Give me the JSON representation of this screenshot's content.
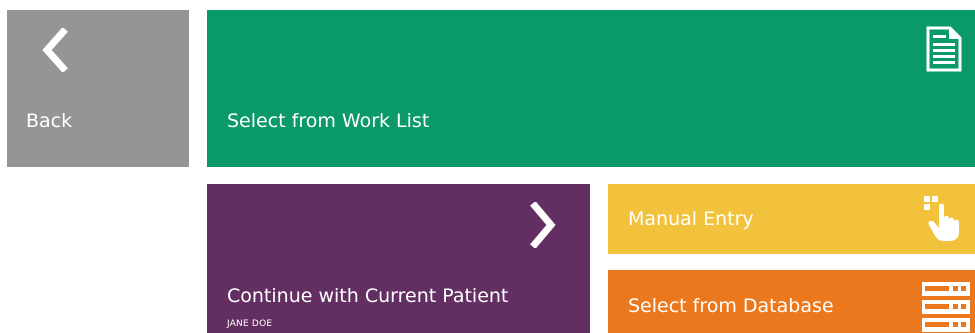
{
  "colors": {
    "back": "#959595",
    "worklist": "#0a9968",
    "continue": "#632f62",
    "manual": "#f2c23c",
    "database": "#ec781d",
    "foreground": "#ffffff"
  },
  "tiles": {
    "back": {
      "label": "Back",
      "icon": "chevron-left-icon"
    },
    "worklist": {
      "label": "Select from Work List",
      "icon": "document-icon"
    },
    "continue": {
      "label": "Continue with Current Patient",
      "patient_name": "JANE DOE",
      "icon": "chevron-right-icon"
    },
    "manual": {
      "label": "Manual Entry",
      "icon": "keypad-hand-icon"
    },
    "database": {
      "label": "Select from Database",
      "icon": "database-icon"
    }
  }
}
